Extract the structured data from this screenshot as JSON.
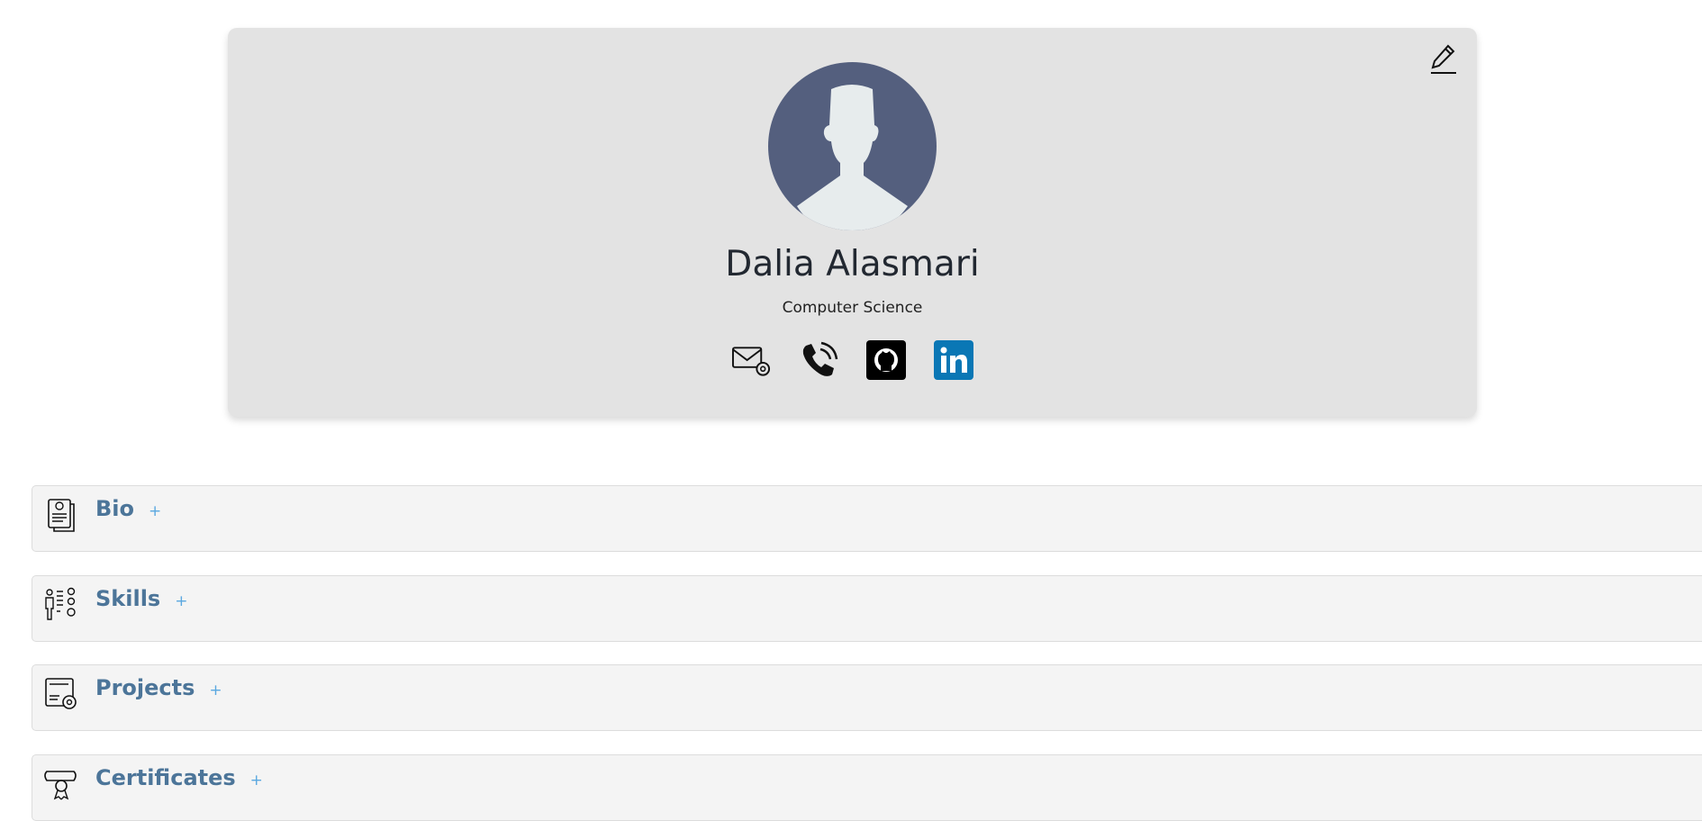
{
  "profile": {
    "name": "Dalia Alasmari",
    "major": "Computer Science"
  },
  "contacts": [
    {
      "icon": "email-icon"
    },
    {
      "icon": "phone-icon"
    },
    {
      "icon": "github-icon"
    },
    {
      "icon": "linkedin-icon"
    }
  ],
  "colors": {
    "card": "#e3e3e3",
    "avatar": "#545f7e",
    "section_title": "#4c7599",
    "plus": "#5aa8e0",
    "linkedin": "#0a77b5"
  },
  "sections": [
    {
      "title": "Bio",
      "plus": "+"
    },
    {
      "title": "Skills",
      "plus": "+"
    },
    {
      "title": "Projects",
      "plus": "+"
    },
    {
      "title": "Certificates",
      "plus": "+"
    }
  ]
}
